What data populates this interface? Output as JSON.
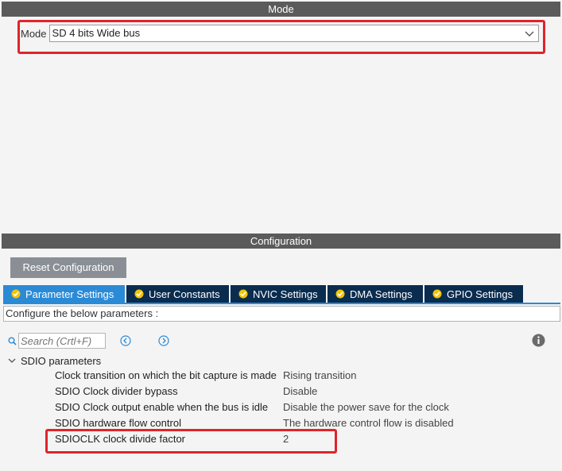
{
  "mode_panel": {
    "title": "Mode",
    "mode_label": "Mode",
    "mode_value": "SD 4 bits Wide bus"
  },
  "config_panel": {
    "title": "Configuration",
    "reset_label": "Reset Configuration",
    "tabs": [
      {
        "label": "Parameter Settings",
        "active": true
      },
      {
        "label": "User Constants",
        "active": false
      },
      {
        "label": "NVIC Settings",
        "active": false
      },
      {
        "label": "DMA Settings",
        "active": false
      },
      {
        "label": "GPIO Settings",
        "active": false
      }
    ],
    "description": "Configure the below parameters :",
    "search_placeholder": "Search (Crtl+F)",
    "group_label": "SDIO parameters",
    "params": [
      {
        "name": "Clock transition on which the bit capture is made",
        "value": "Rising transition"
      },
      {
        "name": "SDIO Clock divider bypass",
        "value": "Disable"
      },
      {
        "name": "SDIO Clock output enable when the bus is idle",
        "value": "Disable the power save for the clock"
      },
      {
        "name": "SDIO hardware flow control",
        "value": "The hardware control flow is disabled"
      },
      {
        "name": "SDIOCLK clock divide factor",
        "value": "2"
      }
    ]
  },
  "colors": {
    "header_bg": "#5b5b5b",
    "tab_active": "#2b8ad6",
    "tab_inactive": "#0a2c4f",
    "highlight": "#e0242b",
    "tab_check": "#f5c400"
  },
  "icons": [
    "chevron-down-icon",
    "check-circle-icon",
    "search-icon",
    "arrow-left-circle-icon",
    "arrow-right-circle-icon",
    "info-icon",
    "expand-chevron-icon"
  ]
}
